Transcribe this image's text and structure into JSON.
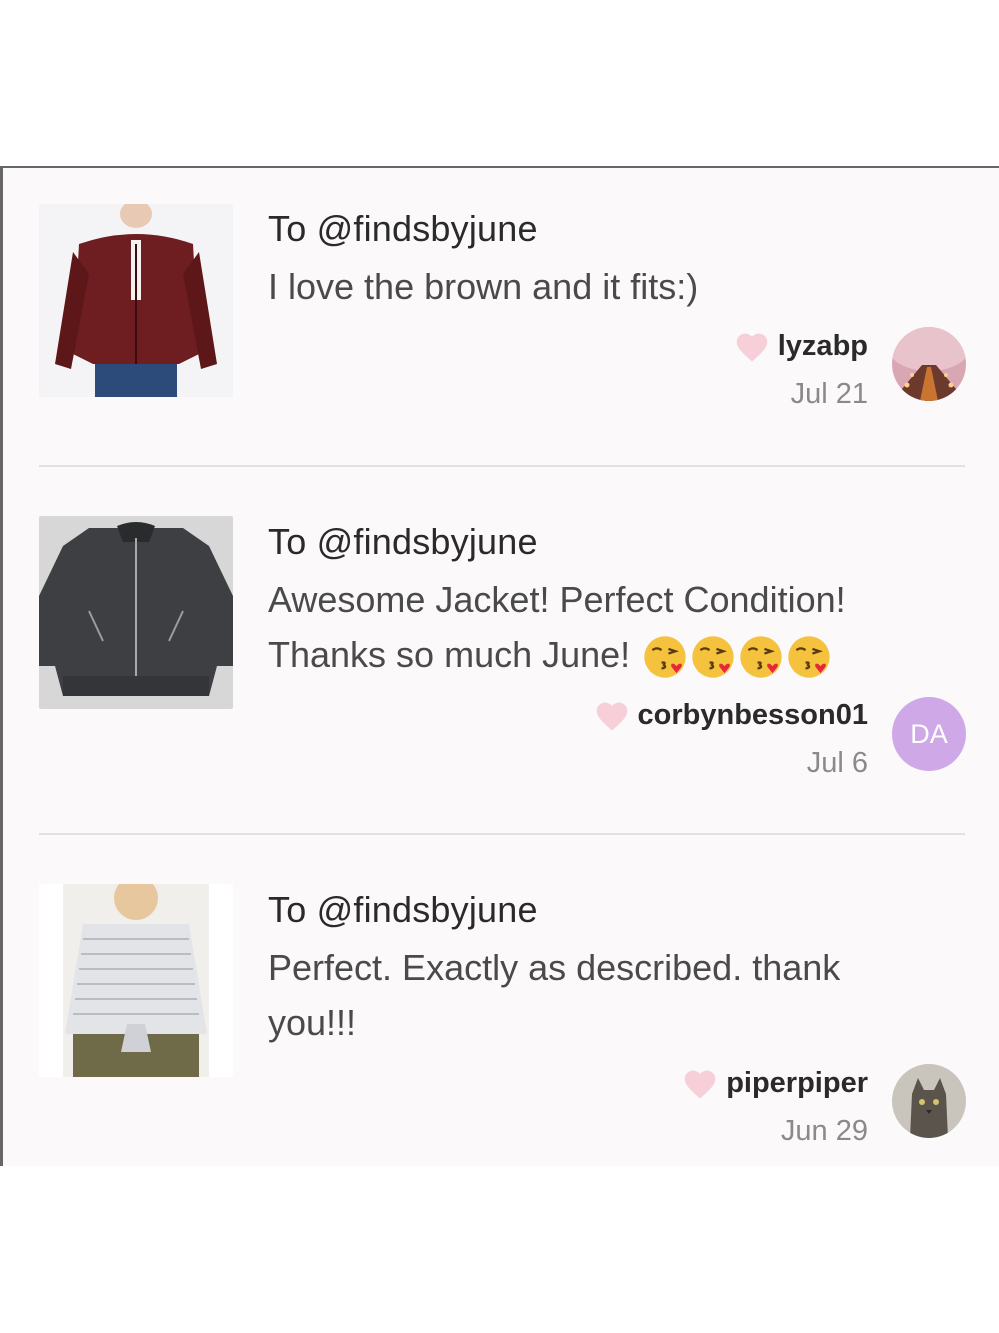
{
  "reviews": [
    {
      "to": "To @findsbyjune",
      "message": "I love the brown and it fits:)",
      "username": "lyzabp",
      "date": "Jul 21",
      "thumbnail": "maroon-leather-jacket-photo",
      "avatar": "cherry-blossom-path-photo"
    },
    {
      "to": "To @findsbyjune",
      "message_line1": "Awesome Jacket! Perfect Condition!",
      "message_line2": "Thanks so much June!",
      "emojis": [
        "kissing-heart-emoji",
        "kissing-heart-emoji",
        "kissing-heart-emoji",
        "kissing-heart-emoji"
      ],
      "username": "corbynbesson01",
      "date": "Jul 6",
      "thumbnail": "dark-gray-leather-jacket-photo",
      "avatar_initials": "DA"
    },
    {
      "to": "To @findsbyjune",
      "message_line1": "Perfect. Exactly as described. thank",
      "message_line2": "you!!!",
      "username": "piperpiper",
      "date": "Jun 29",
      "thumbnail": "striped-tie-front-top-photo",
      "avatar": "cat-photo"
    }
  ],
  "colors": {
    "heart": "#f6cfd8",
    "avatar_initials_bg": "#cfa8e8",
    "divider": "#e4e0e2",
    "panel_bg": "#fbf9fa"
  }
}
